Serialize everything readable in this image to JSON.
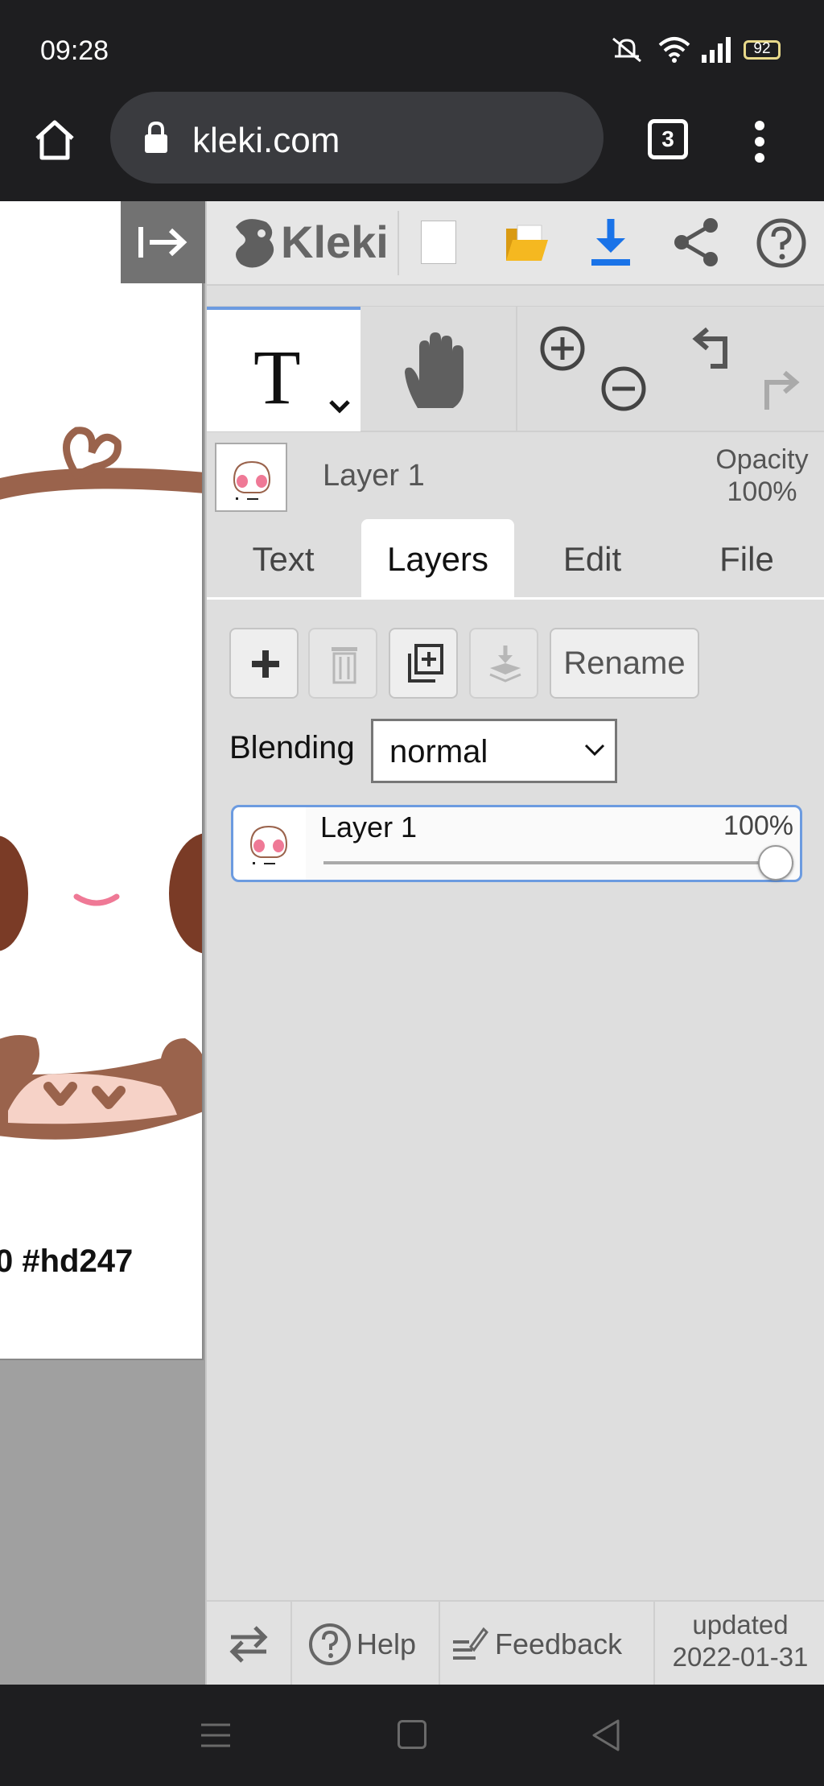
{
  "status": {
    "time": "09:28",
    "battery": "92"
  },
  "browser": {
    "url": "kleki.com",
    "tab_count": "3"
  },
  "canvas": {
    "caption": "0 #hd247"
  },
  "app": {
    "name": "Kleki"
  },
  "layer_header": {
    "name": "Layer 1",
    "opacity_label": "Opacity",
    "opacity_value": "100%"
  },
  "tabs": [
    {
      "label": "Text"
    },
    {
      "label": "Layers"
    },
    {
      "label": "Edit"
    },
    {
      "label": "File"
    }
  ],
  "active_tab": "Layers",
  "layers_panel": {
    "rename_label": "Rename",
    "blending_label": "Blending",
    "blending_value": "normal",
    "layer": {
      "name": "Layer 1",
      "opacity": "100%",
      "opacity_fraction": 1.0
    }
  },
  "footer": {
    "help_label": "Help",
    "feedback_label": "Feedback",
    "updated_label": "updated",
    "updated_date": "2022-01-31"
  },
  "colors": {
    "accent": "#6c9be0",
    "download": "#1a73e8",
    "folder": "#f5b820"
  },
  "icons": [
    "home-icon",
    "lock-icon",
    "tabs-icon",
    "menu-icon",
    "collapse-panel-icon",
    "kleki-logo",
    "new-image-icon",
    "open-folder-icon",
    "download-icon",
    "share-icon",
    "help-icon",
    "text-tool-icon",
    "hand-tool-icon",
    "zoom-in-icon",
    "zoom-out-icon",
    "undo-icon",
    "redo-icon",
    "add-layer-icon",
    "delete-layer-icon",
    "duplicate-layer-icon",
    "merge-down-icon",
    "swap-icon",
    "feedback-icon"
  ]
}
